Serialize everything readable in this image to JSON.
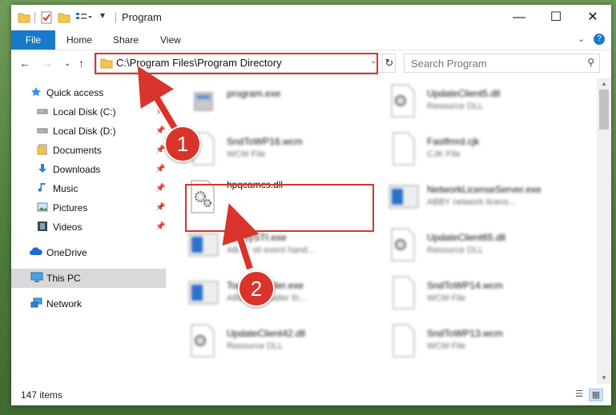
{
  "window": {
    "title": "Program",
    "controls": {
      "minimize": "—",
      "maximize": "☐",
      "close": "✕"
    }
  },
  "ribbon": {
    "tabs": [
      "File",
      "Home",
      "Share",
      "View"
    ],
    "expand": "⌄",
    "help": "?"
  },
  "nav": {
    "back": "←",
    "forward": "→",
    "recent": "⌄",
    "up": "↑",
    "address": "C:\\Program Files\\Program Directory",
    "address_dropdown": "⌄",
    "refresh": "↻",
    "search_placeholder": "Search Program",
    "search_icon": "⚲"
  },
  "sidebar": {
    "pin_glyph": "📌",
    "items": [
      {
        "label": "Quick access",
        "icon": "star-icon",
        "pinned": false
      },
      {
        "label": "Local Disk (C:)",
        "icon": "drive-icon",
        "pinned": true
      },
      {
        "label": "Local Disk (D:)",
        "icon": "drive-icon",
        "pinned": true
      },
      {
        "label": "Documents",
        "icon": "documents-icon",
        "pinned": true
      },
      {
        "label": "Downloads",
        "icon": "download-icon",
        "pinned": true
      },
      {
        "label": "Music",
        "icon": "music-icon",
        "pinned": true
      },
      {
        "label": "Pictures",
        "icon": "pictures-icon",
        "pinned": true
      },
      {
        "label": "Videos",
        "icon": "videos-icon",
        "pinned": true
      },
      {
        "label": "OneDrive",
        "icon": "cloud-icon",
        "pinned": false
      },
      {
        "label": "This PC",
        "icon": "computer-icon",
        "pinned": false,
        "selected": true
      },
      {
        "label": "Network",
        "icon": "network-icon",
        "pinned": false
      }
    ]
  },
  "files": {
    "left": [
      {
        "name": "program.exe",
        "type": "",
        "icon": "exe-icon"
      },
      {
        "name": "SndToWP16.wcm",
        "type": "WCM File",
        "icon": "file-icon"
      },
      {
        "name": "hpqcamcs.dll",
        "type": "",
        "icon": "dll-gear-icon",
        "highlighted": true
      },
      {
        "name": "AbbyySTI.exe",
        "type": "ABBY sti event hand...",
        "icon": "app-window-icon"
      },
      {
        "name": "TouchInstaller.exe",
        "type": "ABBYY Installer th...",
        "icon": "app-window-icon"
      },
      {
        "name": "UpdateClient42.dll",
        "type": "Resource DLL",
        "icon": "dll-gear-icon"
      }
    ],
    "right": [
      {
        "name": "UpdateClient5.dll",
        "type": "Resource DLL",
        "icon": "dll-gear-icon"
      },
      {
        "name": "Fastfmrd.cjk",
        "type": "CJK File",
        "icon": "file-icon"
      },
      {
        "name": "NetworkLicenseServer.exe",
        "type": "ABBY network licens...",
        "icon": "app-window-icon"
      },
      {
        "name": "UpdateClient65.dll",
        "type": "Resource DLL",
        "icon": "dll-gear-icon"
      },
      {
        "name": "SndToWP14.wcm",
        "type": "WCM File",
        "icon": "file-icon"
      },
      {
        "name": "SndToWP13.wcm",
        "type": "WCM File",
        "icon": "file-icon"
      }
    ]
  },
  "status": {
    "count": "147 items"
  },
  "annotations": {
    "step1": "1",
    "step2": "2"
  },
  "colors": {
    "accent": "#1979ca",
    "highlight": "#d9342b",
    "selected": "#d9d9d9"
  }
}
